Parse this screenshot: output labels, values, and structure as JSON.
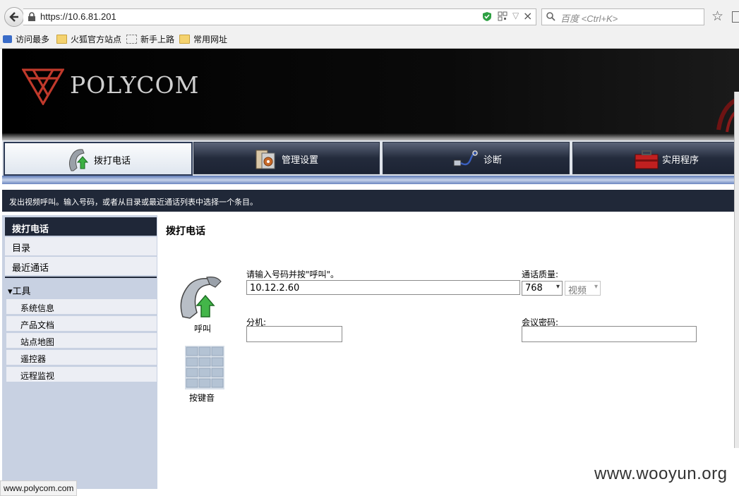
{
  "browser": {
    "url": "https://10.6.81.201",
    "search_placeholder": "百度 <Ctrl+K>",
    "bookmarks": [
      {
        "label": "访问最多",
        "icon": "most-visited-icon"
      },
      {
        "label": "火狐官方站点",
        "icon": "folder-icon"
      },
      {
        "label": "新手上路",
        "icon": "dashed-page-icon"
      },
      {
        "label": "常用网址",
        "icon": "folder-icon"
      }
    ],
    "status_url": "www.polycom.com"
  },
  "brand": {
    "logo_text": "POLYCOM",
    "logo_color": "#c0392b"
  },
  "nav": {
    "tabs": [
      {
        "label": "拨打电话",
        "icon": "phone-call-icon",
        "active": true
      },
      {
        "label": "管理设置",
        "icon": "admin-settings-icon",
        "active": false
      },
      {
        "label": "诊断",
        "icon": "diagnostics-icon",
        "active": false
      },
      {
        "label": "实用程序",
        "icon": "toolbox-icon",
        "active": false
      }
    ],
    "description": "发出视频呼叫。输入号码，或者从目录或最近通话列表中选择一个条目。"
  },
  "sidebar": {
    "header": "拨打电话",
    "items": [
      "目录",
      "最近通话"
    ],
    "tools_label": "▾工具",
    "tools": [
      "系统信息",
      "产品文档",
      "站点地图",
      "遥控器",
      "远程监视"
    ]
  },
  "main": {
    "title": "拨打电话",
    "call_label": "呼叫",
    "keypad_label": "按键音",
    "number_label": "请输入号码并按\"呼叫\"。",
    "number_value": "10.12.2.60",
    "quality_label": "通话质量:",
    "quality_value": "768",
    "call_type_value": "视频",
    "extension_label": "分机:",
    "extension_value": "",
    "password_label": "会议密码:",
    "password_value": ""
  },
  "watermark": "www.wooyun.org"
}
